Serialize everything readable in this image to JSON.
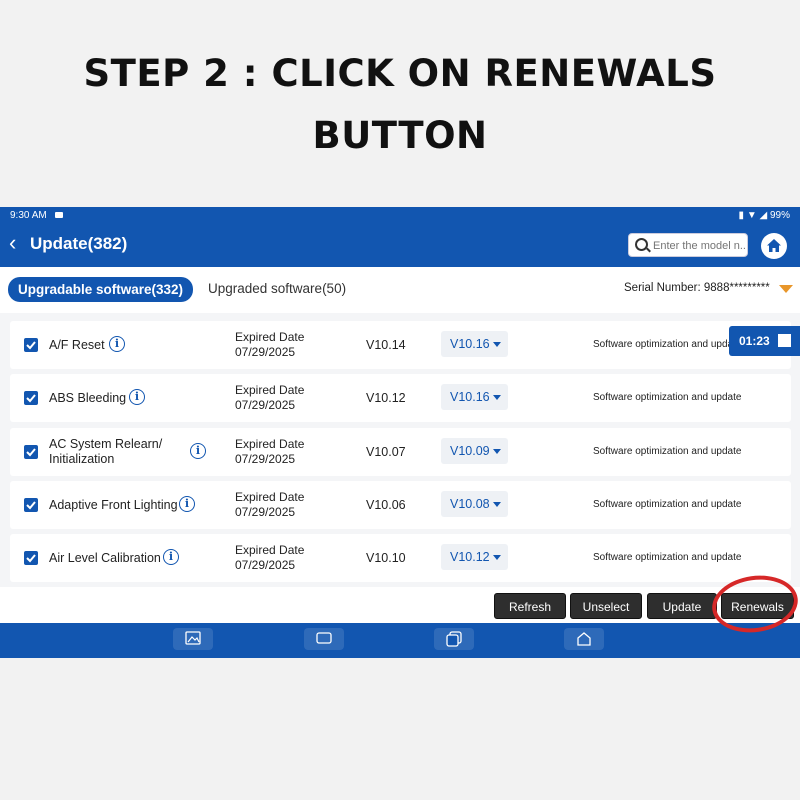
{
  "instruction": {
    "line1": "STEP 2 : CLICK ON RENEWALS",
    "line2": "BUTTON"
  },
  "status_bar": {
    "time": "9:30 AM",
    "battery": "99%"
  },
  "header": {
    "back_label": "Update(382)",
    "search_placeholder": "Enter the model n..."
  },
  "tabs": {
    "active": "Upgradable software(332)",
    "inactive": "Upgraded software(50)",
    "serial": "Serial Number:  9888*********"
  },
  "rows": [
    {
      "name": "A/F Reset",
      "expired_label": "Expired Date",
      "expired_date": "07/29/2025",
      "current": "V10.14",
      "target": "V10.16",
      "desc": "Software optimization and upda"
    },
    {
      "name": "ABS Bleeding",
      "expired_label": "Expired Date",
      "expired_date": "07/29/2025",
      "current": "V10.12",
      "target": "V10.16",
      "desc": "Software optimization and update"
    },
    {
      "name": "AC System Relearn/",
      "name2": "Initialization",
      "expired_label": "Expired Date",
      "expired_date": "07/29/2025",
      "current": "V10.07",
      "target": "V10.09",
      "desc": "Software optimization and update"
    },
    {
      "name": "Adaptive Front Lighting",
      "expired_label": "Expired Date",
      "expired_date": "07/29/2025",
      "current": "V10.06",
      "target": "V10.08",
      "desc": "Software optimization and update"
    },
    {
      "name": "Air Level Calibration",
      "expired_label": "Expired Date",
      "expired_date": "07/29/2025",
      "current": "V10.10",
      "target": "V10.12",
      "desc": "Software optimization and update"
    }
  ],
  "timer": "01:23",
  "actions": {
    "refresh": "Refresh",
    "unselect": "Unselect",
    "update": "Update",
    "renewals": "Renewals"
  },
  "colors": {
    "primary": "#1256b0",
    "highlight_circle": "#d62828",
    "serial_arrow": "#e8962a"
  }
}
